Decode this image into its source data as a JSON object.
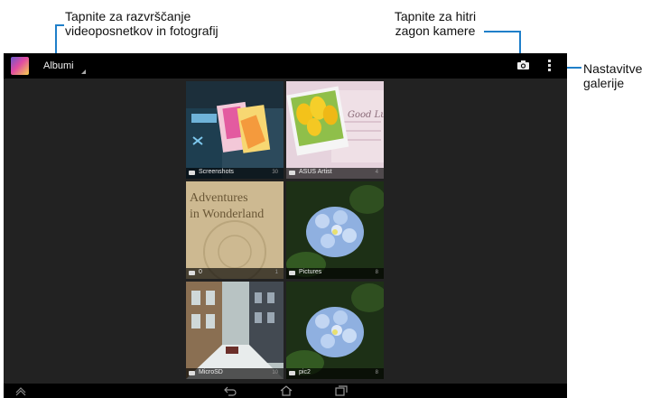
{
  "callouts": {
    "sort": [
      "Tapnite za razvrščanje",
      "videoposnetkov in fotografij"
    ],
    "camera": [
      "Tapnite za hitri",
      "zagon kamere"
    ],
    "settings": [
      "Nastavitve",
      "galerije"
    ]
  },
  "actionbar": {
    "album_label": "Albumi"
  },
  "icons": {
    "app": "gallery-app-icon",
    "camera": "camera-icon",
    "overflow": "overflow-menu-icon",
    "back": "back-icon",
    "home": "home-icon",
    "recent": "recent-apps-icon",
    "collapse": "chevron-up-icon",
    "folder": "folder-icon"
  },
  "albums": [
    {
      "name": "Screenshots",
      "count": "30"
    },
    {
      "name": "ASUS Artist",
      "count": "4"
    },
    {
      "name": "0",
      "count": "1"
    },
    {
      "name": "Pictures",
      "count": "8"
    },
    {
      "name": "MicroSD",
      "count": "10"
    },
    {
      "name": "pic2",
      "count": "8"
    }
  ],
  "artwork": {
    "book_title_line1": "Adventures",
    "book_title_line2": "in Wonderland",
    "card_text": "Good Lu"
  },
  "colors": {
    "accent": "#1f7fc9",
    "screen_bg": "#222222",
    "bar_bg": "#000000"
  }
}
